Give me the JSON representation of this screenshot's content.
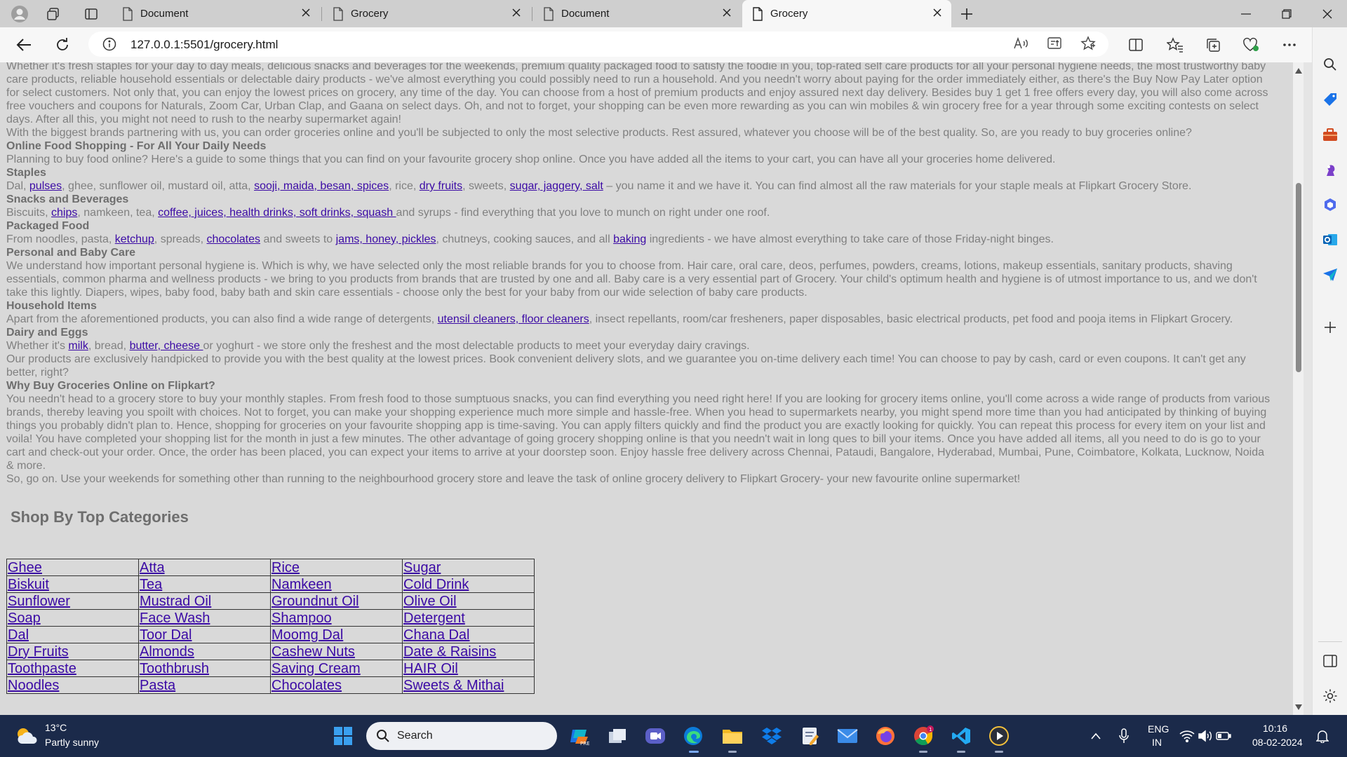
{
  "browser": {
    "tabs": [
      {
        "label": "Document",
        "active": false
      },
      {
        "label": "Grocery",
        "active": false
      },
      {
        "label": "Document",
        "active": false
      },
      {
        "label": "Grocery",
        "active": true
      }
    ],
    "url": "127.0.0.1:5501/grocery.html",
    "icons": [
      "profile-icon",
      "workspaces-icon",
      "tab-actions-icon",
      "new-tab-icon",
      "minimize-icon",
      "restore-icon",
      "close-icon",
      "back-icon",
      "refresh-icon",
      "info-icon",
      "read-aloud-icon",
      "immersive-reader-icon",
      "favorite-star-icon",
      "split-screen-icon",
      "favorites-icon",
      "collections-icon",
      "browser-essentials-icon",
      "more-icon",
      "copilot-icon"
    ]
  },
  "content": {
    "p1a": "Whether it's fresh staples for your day to day meals, delicious snacks and beverages for the weekends, premium quality packaged food to satisfy the foodie in you, top-rated self care products for all your personal hygiene needs, the most trustworthy baby",
    "p1b": "care products, reliable household essentials or delectable dairy products - we've almost everything you could possibly need to run a household. And you needn't worry about paying for the order immediately either, as there's the Buy Now Pay Later option",
    "p1c": "for select customers. Not only that, you can enjoy the lowest prices on grocery, any time of the day. You can choose from a host of premium products and enjoy assured next day delivery. Besides buy 1 get 1 free offers every day, you will also come across",
    "p1d": "free vouchers and coupons for Naturals, Zoom Car, Urban Clap, and Gaana on select days. Oh, and not to forget, your shopping can be even more rewarding as you can win mobiles & win grocery free for a year through some exciting contests on select",
    "p1e": "days. After all this, you might not need to rush to the nearby supermarket again!",
    "p2": "With the biggest brands partnering with us, you can order groceries online and you'll be subjected to only the most selective products. Rest assured, whatever you choose will be of the best quality. So, are you ready to buy groceries online?",
    "h_online": "Online Food Shopping - For All Your Daily Needs",
    "p_online": "Planning to buy food online? Here's a guide to some things that you can find on your favourite grocery shop online. Once you have added all the items to your cart, you can have all your groceries home delivered.",
    "h_staples": "Staples",
    "staples": {
      "t1": "Dal, ",
      "l1": "pulses",
      "t2": ", ghee, sunflower oil, mustard oil, atta, ",
      "l2": "sooji, maida, besan, spices",
      "t3": ", rice, ",
      "l3": "dry fruits",
      "t4": ", sweets, ",
      "l4": "sugar, jaggery, salt",
      "t5": " – you name it and we have it. You can find almost all the raw materials for your staple meals at Flipkart Grocery Store."
    },
    "h_snacks": "Snacks and Beverages",
    "snacks": {
      "t1": "Biscuits, ",
      "l1": "chips",
      "t2": ", namkeen, tea, ",
      "l2": "coffee, juices, health drinks, soft drinks, squash ",
      "t3": "and syrups - find everything that you love to munch on right under one roof."
    },
    "h_packaged": "Packaged Food",
    "packaged": {
      "t1": "From noodles, pasta, ",
      "l1": "ketchup",
      "t2": ", spreads, ",
      "l2": "chocolates",
      "t3": " and sweets to ",
      "l3": "jams, honey, pickles",
      "t4": ", chutneys, cooking sauces, and all ",
      "l4": "baking",
      "t5": " ingredients - we have almost everything to take care of those Friday-night binges."
    },
    "h_personal": "Personal and Baby Care",
    "p_personal_a": "We understand how important personal hygiene is. Which is why, we have selected only the most reliable brands for you to choose from. Hair care, oral care, deos, perfumes, powders, creams, lotions, makeup essentials, sanitary products, shaving",
    "p_personal_b": "essentials, common pharma and wellness products - we bring to you products from brands that are trusted by one and all. Baby care is a very essential part of Grocery. Your child's optimum health and hygiene is of utmost importance to us, and we don't",
    "p_personal_c": "take this lightly. Diapers, wipes, baby food, baby bath and skin care essentials - choose only the best for your baby from our wide selection of baby care products.",
    "h_household": "Household Items",
    "household": {
      "t1": "Apart from the aforementioned products, you can also find a wide range of detergents, ",
      "l1": "utensil cleaners, floor cleaners",
      "t2": ", insect repellants, room/car fresheners, paper disposables, basic electrical products, pet food and pooja items in Flipkart Grocery."
    },
    "h_dairy": "Dairy and Eggs",
    "dairy": {
      "t1": "Whether it's ",
      "l1": "milk",
      "t2": ", bread, ",
      "l2": "butter, cheese ",
      "t3": "or yoghurt - we store only the freshest and the most delectable products to meet your everyday dairy cravings."
    },
    "p_products_a": "Our products are exclusively handpicked to provide you with the best quality at the lowest prices. Book convenient delivery slots, and we guarantee you on-time delivery each time! You can choose to pay by cash, card or even coupons. It can't get any",
    "p_products_b": "better, right?",
    "h_why": "Why Buy Groceries Online on Flipkart?",
    "p_why_a": "You needn't head to a grocery store to buy your monthly staples. From fresh food to those sumptuous snacks, you can find everything you need right here! If you are looking for grocery items online, you'll come across a wide range of products from various",
    "p_why_b": "brands, thereby leaving you spoilt with choices. Not to forget, you can make your shopping experience much more simple and hassle-free. When you head to supermarkets nearby, you might spend more time than you had anticipated by thinking of buying",
    "p_why_c": "things you probably didn't plan to. Hence, shopping for groceries on your favourite shopping app is time-saving. You can apply filters quickly and find the product you are exactly looking for quickly. You can repeat this process for every item on your list and",
    "p_why_d": "voila! You have completed your shopping list for the month in just a few minutes. The other advantage of going grocery shopping online is that you needn't wait in long ques to bill your items. Once you have added all items, all you need to do is go to your",
    "p_why_e": "cart and check-out your order. Once, the order has been placed, you can expect your items to arrive at your doorstep soon. Enjoy hassle free delivery across Chennai, Pataudi, Bangalore, Hyderabad, Mumbai, Pune, Coimbatore, Kolkata, Lucknow, Noida",
    "p_why_f": "& more.",
    "p_final": "So, go on. Use your weekends for something other than running to the neighbourhood grocery store and leave the task of online grocery delivery to Flipkart Grocery- your new favourite online supermarket!",
    "categories_heading": "Shop By Top Categories",
    "categories": [
      [
        "Ghee",
        "Atta",
        "Rice",
        "Sugar"
      ],
      [
        "Biskuit",
        "Tea",
        "Namkeen",
        "Cold Drink"
      ],
      [
        "Sunflower",
        "Mustrad Oil",
        "Groundnut Oil",
        "Olive Oil"
      ],
      [
        "Soap",
        "Face Wash",
        "Shampoo",
        "Detergent"
      ],
      [
        "Dal",
        "Toor Dal",
        "Moomg Dal",
        "Chana Dal"
      ],
      [
        "Dry Fruits",
        "Almonds",
        "Cashew Nuts",
        "Date & Raisins"
      ],
      [
        "Toothpaste",
        "Toothbrush",
        "Saving Cream",
        "HAIR Oil"
      ],
      [
        "Noodles",
        "Pasta",
        "Chocolates",
        "Sweets & Mithai"
      ]
    ]
  },
  "sidebar": {
    "icons": [
      "search-icon",
      "shopping-tag-icon",
      "tools-icon",
      "games-icon",
      "copilot-sidebar-icon",
      "outlook-icon",
      "send-icon",
      "add-icon",
      "panel-icon",
      "settings-icon"
    ]
  },
  "taskbar": {
    "weather_temp": "13°C",
    "weather_desc": "Partly sunny",
    "search_label": "Search",
    "lang_line1": "ENG",
    "lang_line2": "IN",
    "time": "10:16",
    "date": "08-02-2024"
  },
  "colors": {
    "link": "#3b0aa5",
    "page_bg": "#d9d9d9",
    "taskbar_bg": "#1b2a4a"
  }
}
